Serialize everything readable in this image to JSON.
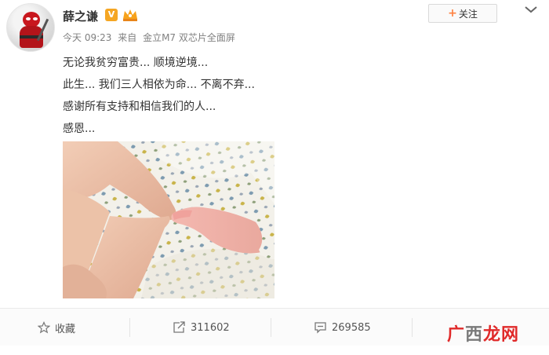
{
  "user": {
    "name": "薛之谦",
    "verified_badge": "V"
  },
  "meta": {
    "time": "今天 09:23",
    "source_prefix": "来自",
    "source": "金立M7 双芯片全面屏"
  },
  "follow_button": {
    "label": "关注"
  },
  "content": {
    "lines": [
      "无论我贫穷富贵... 顺境逆境...",
      "此生... 我们三人相依为命... 不离不弃...",
      "感谢所有支持和相信我们的人...",
      "感恩..."
    ]
  },
  "actions": {
    "favorite_label": "收藏",
    "repost_count": "311602",
    "comment_count": "269585"
  },
  "watermark": {
    "part1": "广",
    "part2": "西",
    "part3": "龙网"
  },
  "colors": {
    "accent_orange": "#ff8140",
    "verified": "#f5a623",
    "text": "#333333",
    "meta": "#808080"
  }
}
